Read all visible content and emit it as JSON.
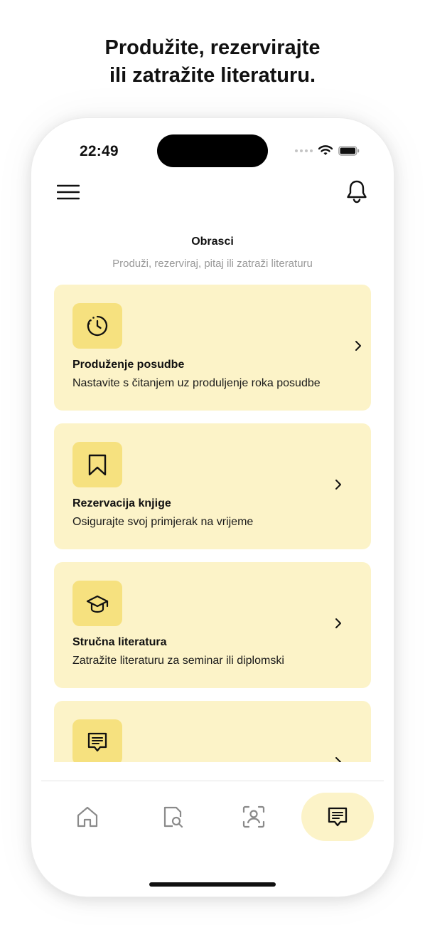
{
  "headline": {
    "line1": "Produžite, rezervirajte",
    "line2": "ili zatražite literaturu."
  },
  "status_bar": {
    "time": "22:49",
    "icons": [
      "signal-dots-icon",
      "wifi-icon",
      "battery-icon"
    ]
  },
  "header": {
    "menu_icon": "hamburger-menu-icon",
    "notification_icon": "bell-icon"
  },
  "page": {
    "title": "Obrasci",
    "subtitle": "Produži, rezerviraj, pitaj ili zatraži literaturu"
  },
  "cards": [
    {
      "icon": "clock-icon",
      "title": "Produženje posudbe",
      "description": "Nastavite s čitanjem uz produljenje roka posudbe"
    },
    {
      "icon": "bookmark-icon",
      "title": "Rezervacija knjige",
      "description": "Osigurajte svoj primjerak na vrijeme"
    },
    {
      "icon": "graduation-cap-icon",
      "title": "Stručna literatura",
      "description": "Zatražite literaturu za seminar ili diplomski"
    },
    {
      "icon": "message-icon",
      "title": "",
      "description": ""
    }
  ],
  "tab_bar": {
    "tabs": [
      {
        "icon": "home-icon",
        "active": false
      },
      {
        "icon": "document-search-icon",
        "active": false
      },
      {
        "icon": "scan-person-icon",
        "active": false
      },
      {
        "icon": "message-icon",
        "active": true
      }
    ]
  },
  "colors": {
    "card_background": "#fcf3c8",
    "icon_background": "#f6e17f",
    "active_tab_background": "#fcf3c8",
    "subtitle_text": "#9a9a9a"
  }
}
